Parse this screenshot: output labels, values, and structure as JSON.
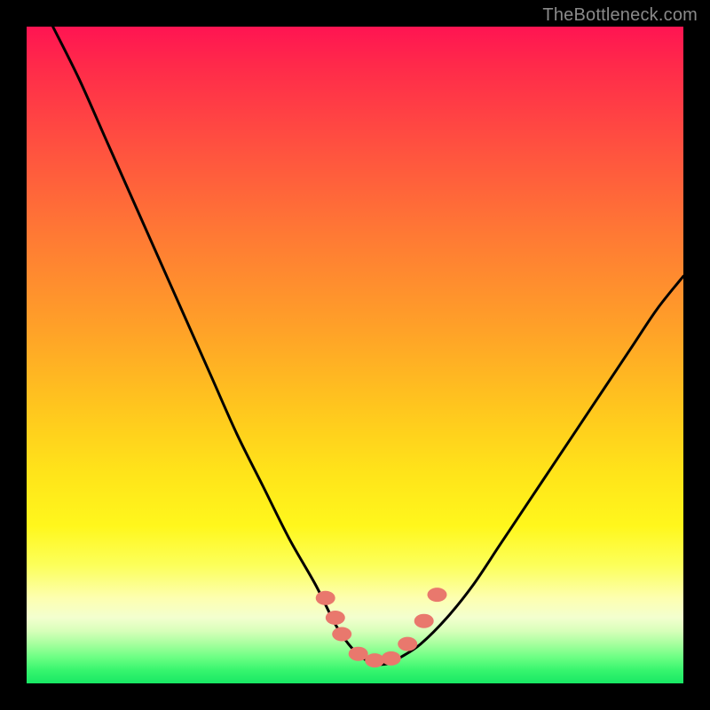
{
  "watermark": "TheBottleneck.com",
  "chart_data": {
    "type": "line",
    "title": "",
    "xlabel": "",
    "ylabel": "",
    "xlim": [
      0,
      100
    ],
    "ylim": [
      0,
      100
    ],
    "grid": false,
    "legend": false,
    "annotations": [],
    "series": [
      {
        "name": "bottleneck-curve",
        "x": [
          4,
          8,
          12,
          16,
          20,
          24,
          28,
          32,
          36,
          40,
          44,
          47,
          49,
          51,
          53,
          55,
          57,
          60,
          64,
          68,
          72,
          76,
          80,
          84,
          88,
          92,
          96,
          100
        ],
        "y": [
          100,
          92,
          83,
          74,
          65,
          56,
          47,
          38,
          30,
          22,
          15,
          9,
          6,
          4,
          3,
          3,
          4,
          6,
          10,
          15,
          21,
          27,
          33,
          39,
          45,
          51,
          57,
          62
        ]
      }
    ],
    "markers": [
      {
        "name": "left-upper-marker",
        "x": 45.5,
        "y": 13.0
      },
      {
        "name": "left-mid-marker",
        "x": 47.0,
        "y": 10.0
      },
      {
        "name": "left-lower-marker",
        "x": 48.0,
        "y": 7.5
      },
      {
        "name": "valley-marker-1",
        "x": 50.5,
        "y": 4.5
      },
      {
        "name": "valley-marker-2",
        "x": 53.0,
        "y": 3.5
      },
      {
        "name": "valley-marker-3",
        "x": 55.5,
        "y": 3.8
      },
      {
        "name": "right-lower-marker",
        "x": 58.0,
        "y": 6.0
      },
      {
        "name": "right-mid-marker",
        "x": 60.5,
        "y": 9.5
      },
      {
        "name": "right-upper-marker",
        "x": 62.5,
        "y": 13.5
      }
    ],
    "marker_color": "#e9786d",
    "curve_color": "#000000"
  }
}
